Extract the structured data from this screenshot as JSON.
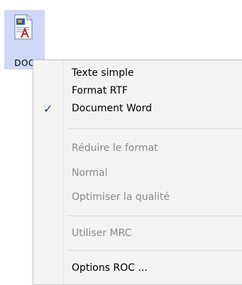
{
  "file": {
    "icon": "word-document-icon",
    "label": "DOC"
  },
  "menu": {
    "items": [
      {
        "label": "Texte simple",
        "enabled": true,
        "checked": false
      },
      {
        "label": "Format RTF",
        "enabled": true,
        "checked": false
      },
      {
        "label": "Document Word",
        "enabled": true,
        "checked": true
      },
      {
        "label": "Réduire le format",
        "enabled": false,
        "checked": false
      },
      {
        "label": "Normal",
        "enabled": false,
        "checked": false
      },
      {
        "label": "Optimiser la qualité",
        "enabled": false,
        "checked": false
      },
      {
        "label": "Utiliser MRC",
        "enabled": false,
        "checked": false
      },
      {
        "label": "Options ROC ...",
        "enabled": true,
        "checked": false
      }
    ],
    "check_glyph": "✓"
  },
  "colors": {
    "tile_highlight": "#cfd8f7",
    "menu_background": "#f3f3f3",
    "disabled_text": "#8b8b8b",
    "check_color": "#1b3a7a"
  }
}
